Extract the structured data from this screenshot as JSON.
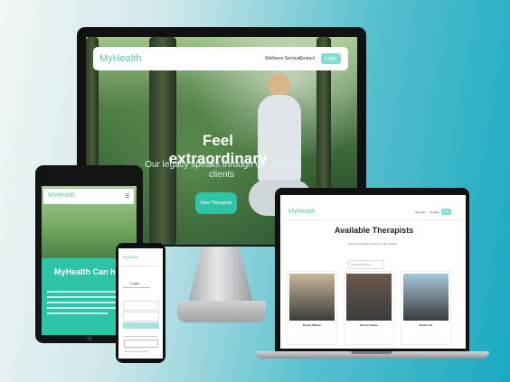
{
  "desktop": {
    "logo": "MyHealth",
    "nav_items": [
      "Wellness Services",
      "Contact"
    ],
    "login_label": "Login",
    "hero_title": "Feel extraordinary",
    "hero_subtitle": "Our legacy speaks through our healed clients",
    "cta_label": "View Therapists"
  },
  "tablet": {
    "logo": "MyHealth",
    "menu_icon": "hamburger-icon",
    "heading": "MyHealth Can help You"
  },
  "phone": {
    "logo": "MyHealth",
    "heading": "Login"
  },
  "laptop": {
    "logo": "MyHealth",
    "nav_items": [
      "Services",
      "Contact"
    ],
    "login_label": "Login",
    "title": "Available Therapists",
    "subtitle": "Choose a therapy session to get started!",
    "search_placeholder": "Search por Nam",
    "therapists": [
      {
        "name": "Doctor Wilson",
        "photo_color": "#c9b79c"
      },
      {
        "name": "Doctor House",
        "photo_color": "#6b5b4f"
      },
      {
        "name": "Doctor Oz",
        "photo_color": "#a6c7dc"
      }
    ]
  },
  "colors": {
    "brand": "#5cc7b0",
    "accent": "#2ec4a7",
    "background_left": "#f3f6f6",
    "background_right": "#1aa9c2"
  }
}
